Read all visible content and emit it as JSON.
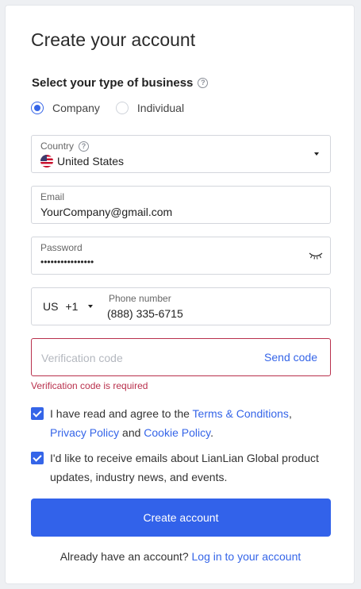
{
  "title": "Create your account",
  "business_type": {
    "label": "Select your type of business",
    "help_icon": "question-circle-icon",
    "options": [
      {
        "label": "Company",
        "selected": true
      },
      {
        "label": "Individual",
        "selected": false
      }
    ]
  },
  "country": {
    "label": "Country",
    "help_icon": "question-circle-icon",
    "value": "United States",
    "flag_icon": "us-flag-icon"
  },
  "email": {
    "label": "Email",
    "value": "YourCompany@gmail.com"
  },
  "password": {
    "label": "Password",
    "value": "••••••••••••••••",
    "toggle_icon": "eye-closed-icon"
  },
  "phone": {
    "country_code": "US",
    "dial_code": "+1",
    "label": "Phone number",
    "value": "(888) 335-6715"
  },
  "verification": {
    "placeholder": "Verification code",
    "send_label": "Send code",
    "error": "Verification code is required"
  },
  "consent_terms": {
    "checked": true,
    "text_1": "I have read and agree to the ",
    "terms_link": "Terms & Conditions",
    "text_2": ",",
    "privacy_link": "Privacy Policy",
    "text_3": " and ",
    "cookie_link": "Cookie Policy",
    "text_4": "."
  },
  "consent_marketing": {
    "checked": true,
    "text": "I'd like to receive emails about LianLian Global product updates, industry news, and events."
  },
  "submit_label": "Create account",
  "footer": {
    "prompt": "Already have an account?",
    "login_link": "Log in to your account"
  },
  "colors": {
    "primary": "#3262ea",
    "link": "#3565e8",
    "error": "#b9304c"
  }
}
